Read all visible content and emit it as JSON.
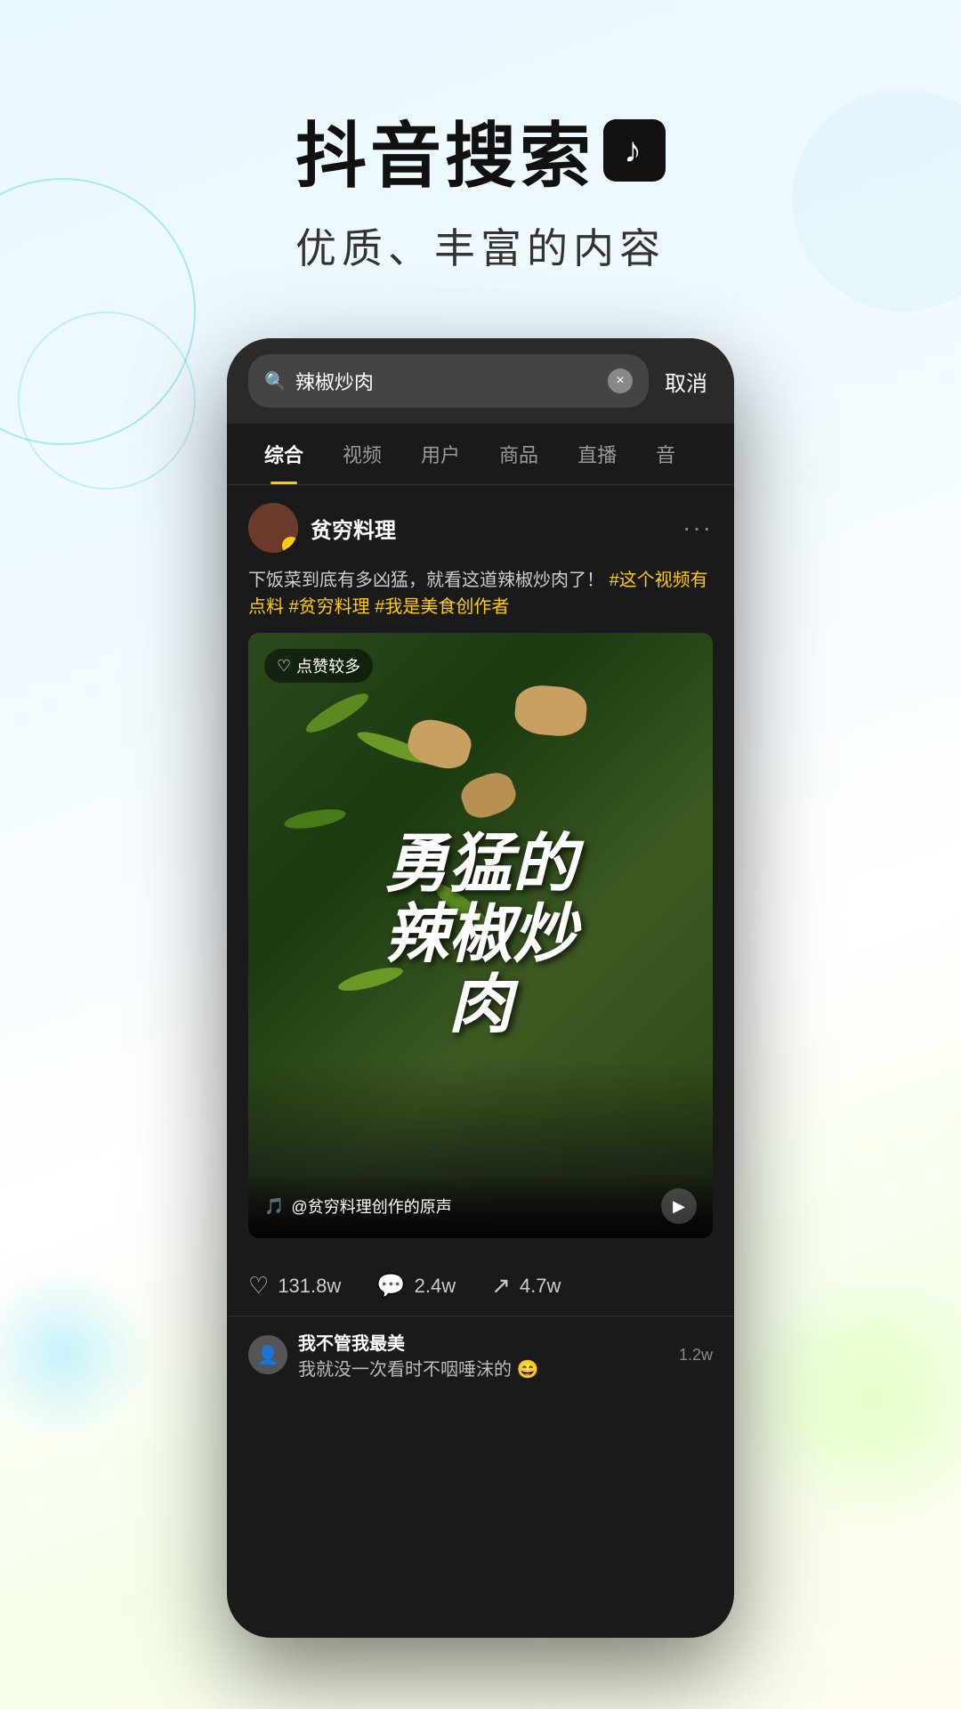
{
  "page": {
    "background_note": "light blue-white-green gradient background"
  },
  "header": {
    "main_title": "抖音搜索",
    "subtitle": "优质、丰富的内容",
    "logo_symbol": "♪"
  },
  "phone": {
    "search": {
      "query": "辣椒炒肉",
      "clear_label": "×",
      "cancel_label": "取消"
    },
    "tabs": [
      {
        "label": "综合",
        "active": true
      },
      {
        "label": "视频",
        "active": false
      },
      {
        "label": "用户",
        "active": false
      },
      {
        "label": "商品",
        "active": false
      },
      {
        "label": "直播",
        "active": false
      },
      {
        "label": "音",
        "active": false
      }
    ],
    "post": {
      "username": "贫穷料理",
      "verified": true,
      "description": "下饭菜到底有多凶猛，就看这道辣椒炒肉了！",
      "hashtags": [
        "#这个视频有点料",
        "#贫穷料理",
        "#我是美食创作者"
      ],
      "likes_badge": "点赞较多",
      "video_text": "勇猛的辣椒炒肉",
      "video_sound": "@贫穷料理创作的原声",
      "engagement": {
        "likes": "131.8w",
        "comments": "2.4w",
        "shares": "4.7w"
      }
    },
    "comment_preview": {
      "commenter": "我不管我最美",
      "text": "我就没一次看时不咽唾沫的 😄",
      "likes": "1.2w"
    }
  }
}
